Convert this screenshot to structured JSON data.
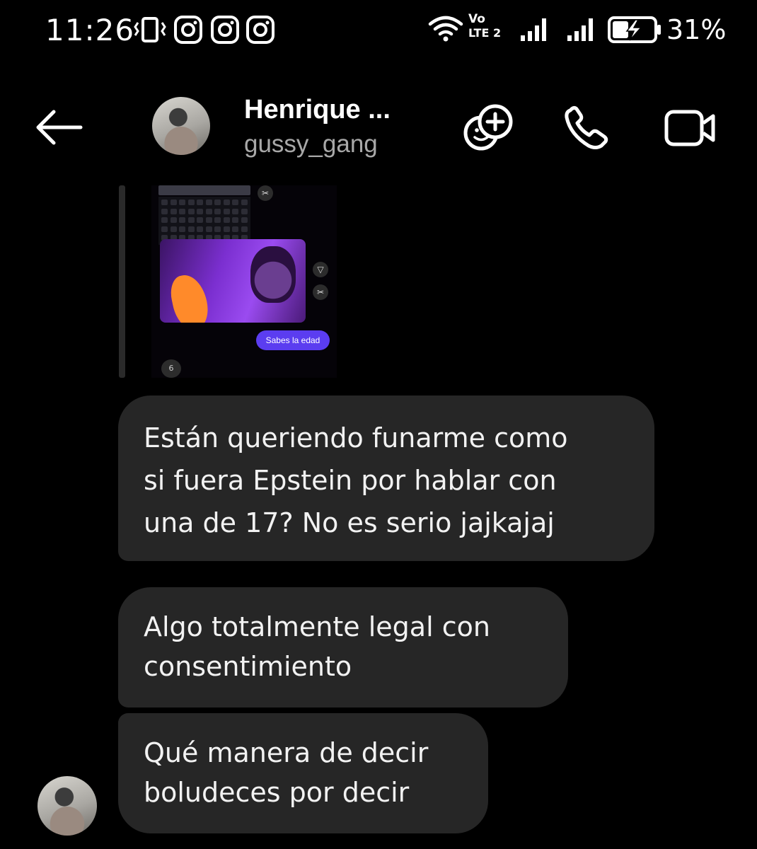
{
  "status_bar": {
    "time": "11:26",
    "icons": [
      "vibrate-icon",
      "instagram-icon",
      "instagram-icon",
      "instagram-icon",
      "wifi-icon",
      "volte-icon",
      "signal-icon",
      "signal-icon",
      "battery-charging-icon"
    ],
    "network_label_top": "Vo",
    "network_label_bottom": "LTE 2",
    "battery_percent": "31%"
  },
  "header": {
    "name": "Henrique ...",
    "username": "gussy_gang",
    "actions": [
      "add-people-icon",
      "phone-icon",
      "video-icon"
    ]
  },
  "shared_media": {
    "button_label": "Sabes la edad",
    "time_badge": "6"
  },
  "messages": [
    {
      "text": "Están queriendo funarme como\nsi fuera Epstein por hablar con\nuna de 17? No es serio jajkajaj"
    },
    {
      "text": "Algo totalmente legal con\nconsentimiento"
    },
    {
      "text": "Qué manera de decir\nboludeces por decir"
    }
  ],
  "colors": {
    "background": "#000000",
    "bubble": "#262626",
    "username": "#a8a8a8",
    "accent_purple": "#5b3df0",
    "scribble_orange": "#ff8a2a"
  }
}
